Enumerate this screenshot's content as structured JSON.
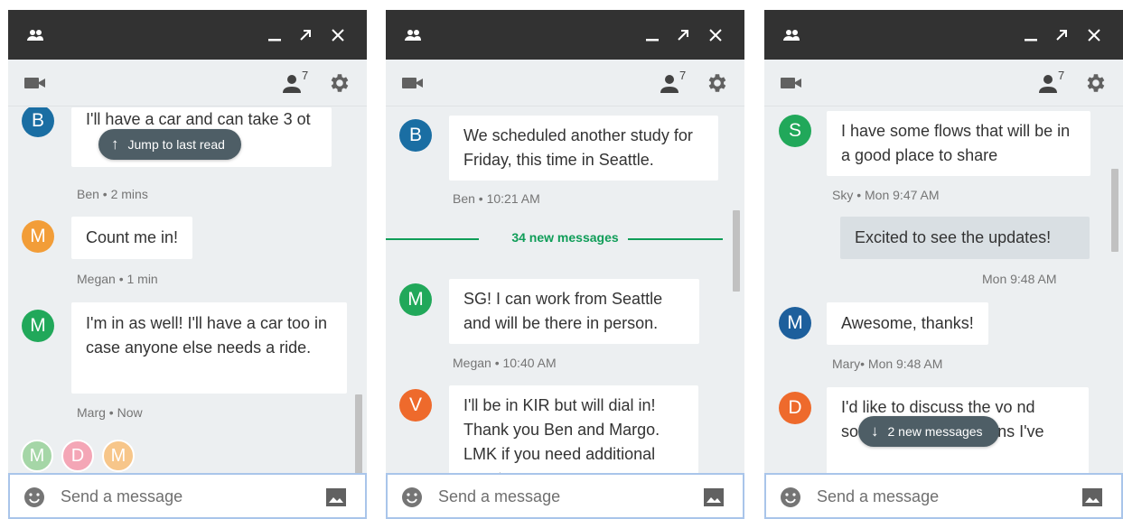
{
  "colors": {
    "titlebar": "#323232",
    "background": "#eceff1",
    "accent_green": "#0f9d58",
    "avatar_blue": "#1a6ea3",
    "avatar_orange": "#f29d38",
    "avatar_green": "#21a85a",
    "avatar_red_orange": "#ee6a2c",
    "avatar_navy": "#1d5f9c",
    "pill": "#4e5e66"
  },
  "window": {
    "titlebar_icons": [
      "people-icon",
      "minimize-icon",
      "pop-out-icon",
      "close-icon"
    ],
    "toolbar_icons": [
      "video-icon",
      "member-icon",
      "gear-icon"
    ],
    "member_count": "7",
    "composer_placeholder": "Send a message",
    "composer_icons": [
      "emoji-icon",
      "image-icon"
    ]
  },
  "panel1": {
    "messages": [
      {
        "initial": "B",
        "text": "I'll have a car and can take 3 ot",
        "meta": "Ben • 2 mins"
      },
      {
        "initial": "M",
        "text": "Count me in!",
        "meta": "Megan • 1 min"
      },
      {
        "initial": "M",
        "text": "I'm in as well!  I'll have a car too in case anyone else needs a ride.",
        "meta": "Marg • Now"
      }
    ],
    "jump_pill": "Jump to last read",
    "read_receipts": [
      "M",
      "D",
      "M"
    ]
  },
  "panel2": {
    "messages": [
      {
        "initial": "B",
        "text": "We scheduled another study for Friday, this time in Seattle.",
        "meta": "Ben • 10:21 AM"
      },
      {
        "initial": "M",
        "text": "SG! I can work from Seattle and will be there in person.",
        "meta": "Megan • 10:40 AM"
      },
      {
        "initial": "V",
        "text": "I'll be in KIR but will dial in! Thank you Ben and Margo. LMK if you need additional assets",
        "meta": ""
      }
    ],
    "divider_label": "34 new messages"
  },
  "panel3": {
    "messages": [
      {
        "initial": "S",
        "text": "I have some flows that will be in a good place to share",
        "meta": "Sky • Mon 9:47 AM"
      },
      {
        "initial": "",
        "text": "Excited to see the updates!",
        "meta": "Mon 9:48 AM"
      },
      {
        "initial": "M",
        "text": "Awesome, thanks!",
        "meta": "Mary• Mon 9:48 AM"
      },
      {
        "initial": "D",
        "text": "I'd like to discuss the vo                                   nd some recommendations I've",
        "meta": ""
      }
    ],
    "new_pill": "2 new messages"
  }
}
